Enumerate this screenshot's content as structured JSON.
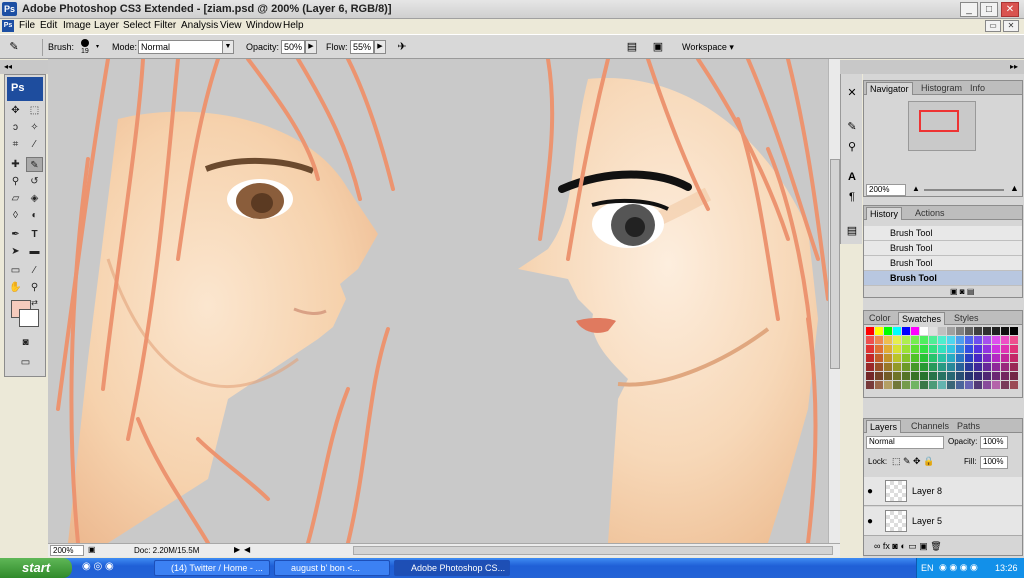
{
  "titlebar": {
    "title": "Adobe Photoshop CS3 Extended - [ziam.psd @ 200% (Layer 6, RGB/8)]",
    "app_icon": "Ps"
  },
  "menu": [
    "File",
    "Edit",
    "Image",
    "Layer",
    "Select",
    "Filter",
    "Analysis",
    "View",
    "Window",
    "Help"
  ],
  "options": {
    "brush_label": "Brush:",
    "brush_size": "19",
    "mode_label": "Mode:",
    "mode_value": "Normal",
    "opacity_label": "Opacity:",
    "opacity_value": "50%",
    "flow_label": "Flow:",
    "flow_value": "55%",
    "workspace_label": "Workspace ▾"
  },
  "toolbar": {
    "logo": "Ps"
  },
  "colors": {
    "foreground": "#f5cbbd",
    "background": "#ffffff",
    "accent": "#1e4d9e"
  },
  "status": {
    "zoom": "200%",
    "doc": "Doc: 2.20M/15.5M"
  },
  "navigator": {
    "tabs": [
      "Navigator",
      "Histogram",
      "Info"
    ],
    "zoom": "200%"
  },
  "history": {
    "tabs": [
      "History",
      "Actions"
    ],
    "items": [
      "Brush Tool",
      "Brush Tool",
      "Brush Tool",
      "Brush Tool"
    ]
  },
  "swatches": {
    "tabs": [
      "Color",
      "Swatches",
      "Styles"
    ]
  },
  "layers": {
    "tabs": [
      "Layers",
      "Channels",
      "Paths"
    ],
    "blend_mode": "Normal",
    "opacity_label": "Opacity:",
    "opacity_value": "100%",
    "lock_label": "Lock:",
    "fill_label": "Fill:",
    "fill_value": "100%",
    "items": [
      "Layer 8",
      "Layer 5"
    ]
  },
  "taskbar": {
    "start": "start",
    "buttons": [
      "(14) Twitter / Home - ...",
      "august b' bon <...",
      "Adobe Photoshop CS..."
    ],
    "lang": "EN",
    "clock": "13:26"
  }
}
